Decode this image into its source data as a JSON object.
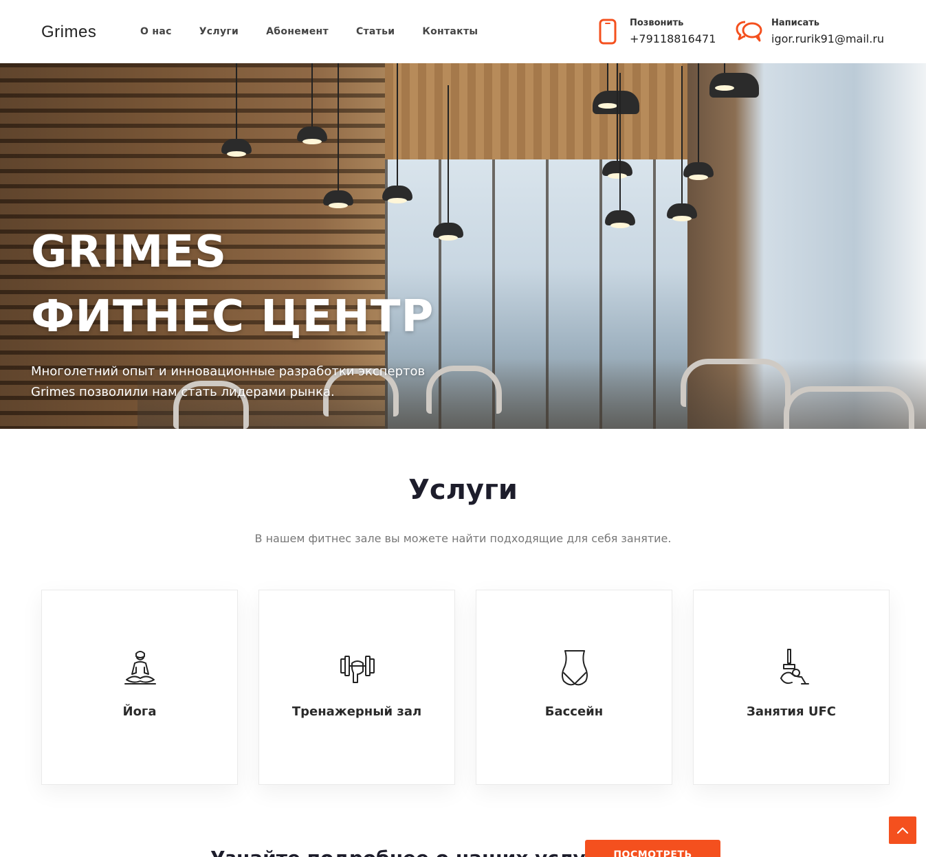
{
  "header": {
    "logo": "Grimes",
    "nav": [
      "О нас",
      "Услуги",
      "Абонемент",
      "Статьи",
      "Контакты"
    ],
    "phone": {
      "label": "Позвонить",
      "value": "+79118816471",
      "icon": "phone-icon"
    },
    "mail": {
      "label": "Написать",
      "value": "igor.rurik91@mail.ru",
      "icon": "chat-icon"
    }
  },
  "hero": {
    "title_line1": "GRIMES",
    "title_line2": "ФИТНЕС ЦЕНТР",
    "text_line1": "Многолетний опыт и инновационные разработки экспертов",
    "text_line2": "Grimes позволили нам стать лидерами рынка."
  },
  "services": {
    "title": "Услуги",
    "subtitle": "В нашем фитнес зале вы можете найти подходящие для себя занятие.",
    "cards": [
      {
        "label": "Йога",
        "icon": "yoga-icon"
      },
      {
        "label": "Тренажерный зал",
        "icon": "dumbbell-icon"
      },
      {
        "label": "Бассейн",
        "icon": "waist-icon"
      },
      {
        "label": "Занятия UFC",
        "icon": "stretch-icon"
      }
    ]
  },
  "bottom": {
    "text": "Узнайте подробнее о наших услугах",
    "button": "ПОСМОТРЕТЬ"
  },
  "scroll_top": {
    "label": "ВВЕРХ",
    "icon": "chevron-up-icon"
  },
  "colors": {
    "accent": "#f4501e",
    "title": "#1d1d2b"
  }
}
